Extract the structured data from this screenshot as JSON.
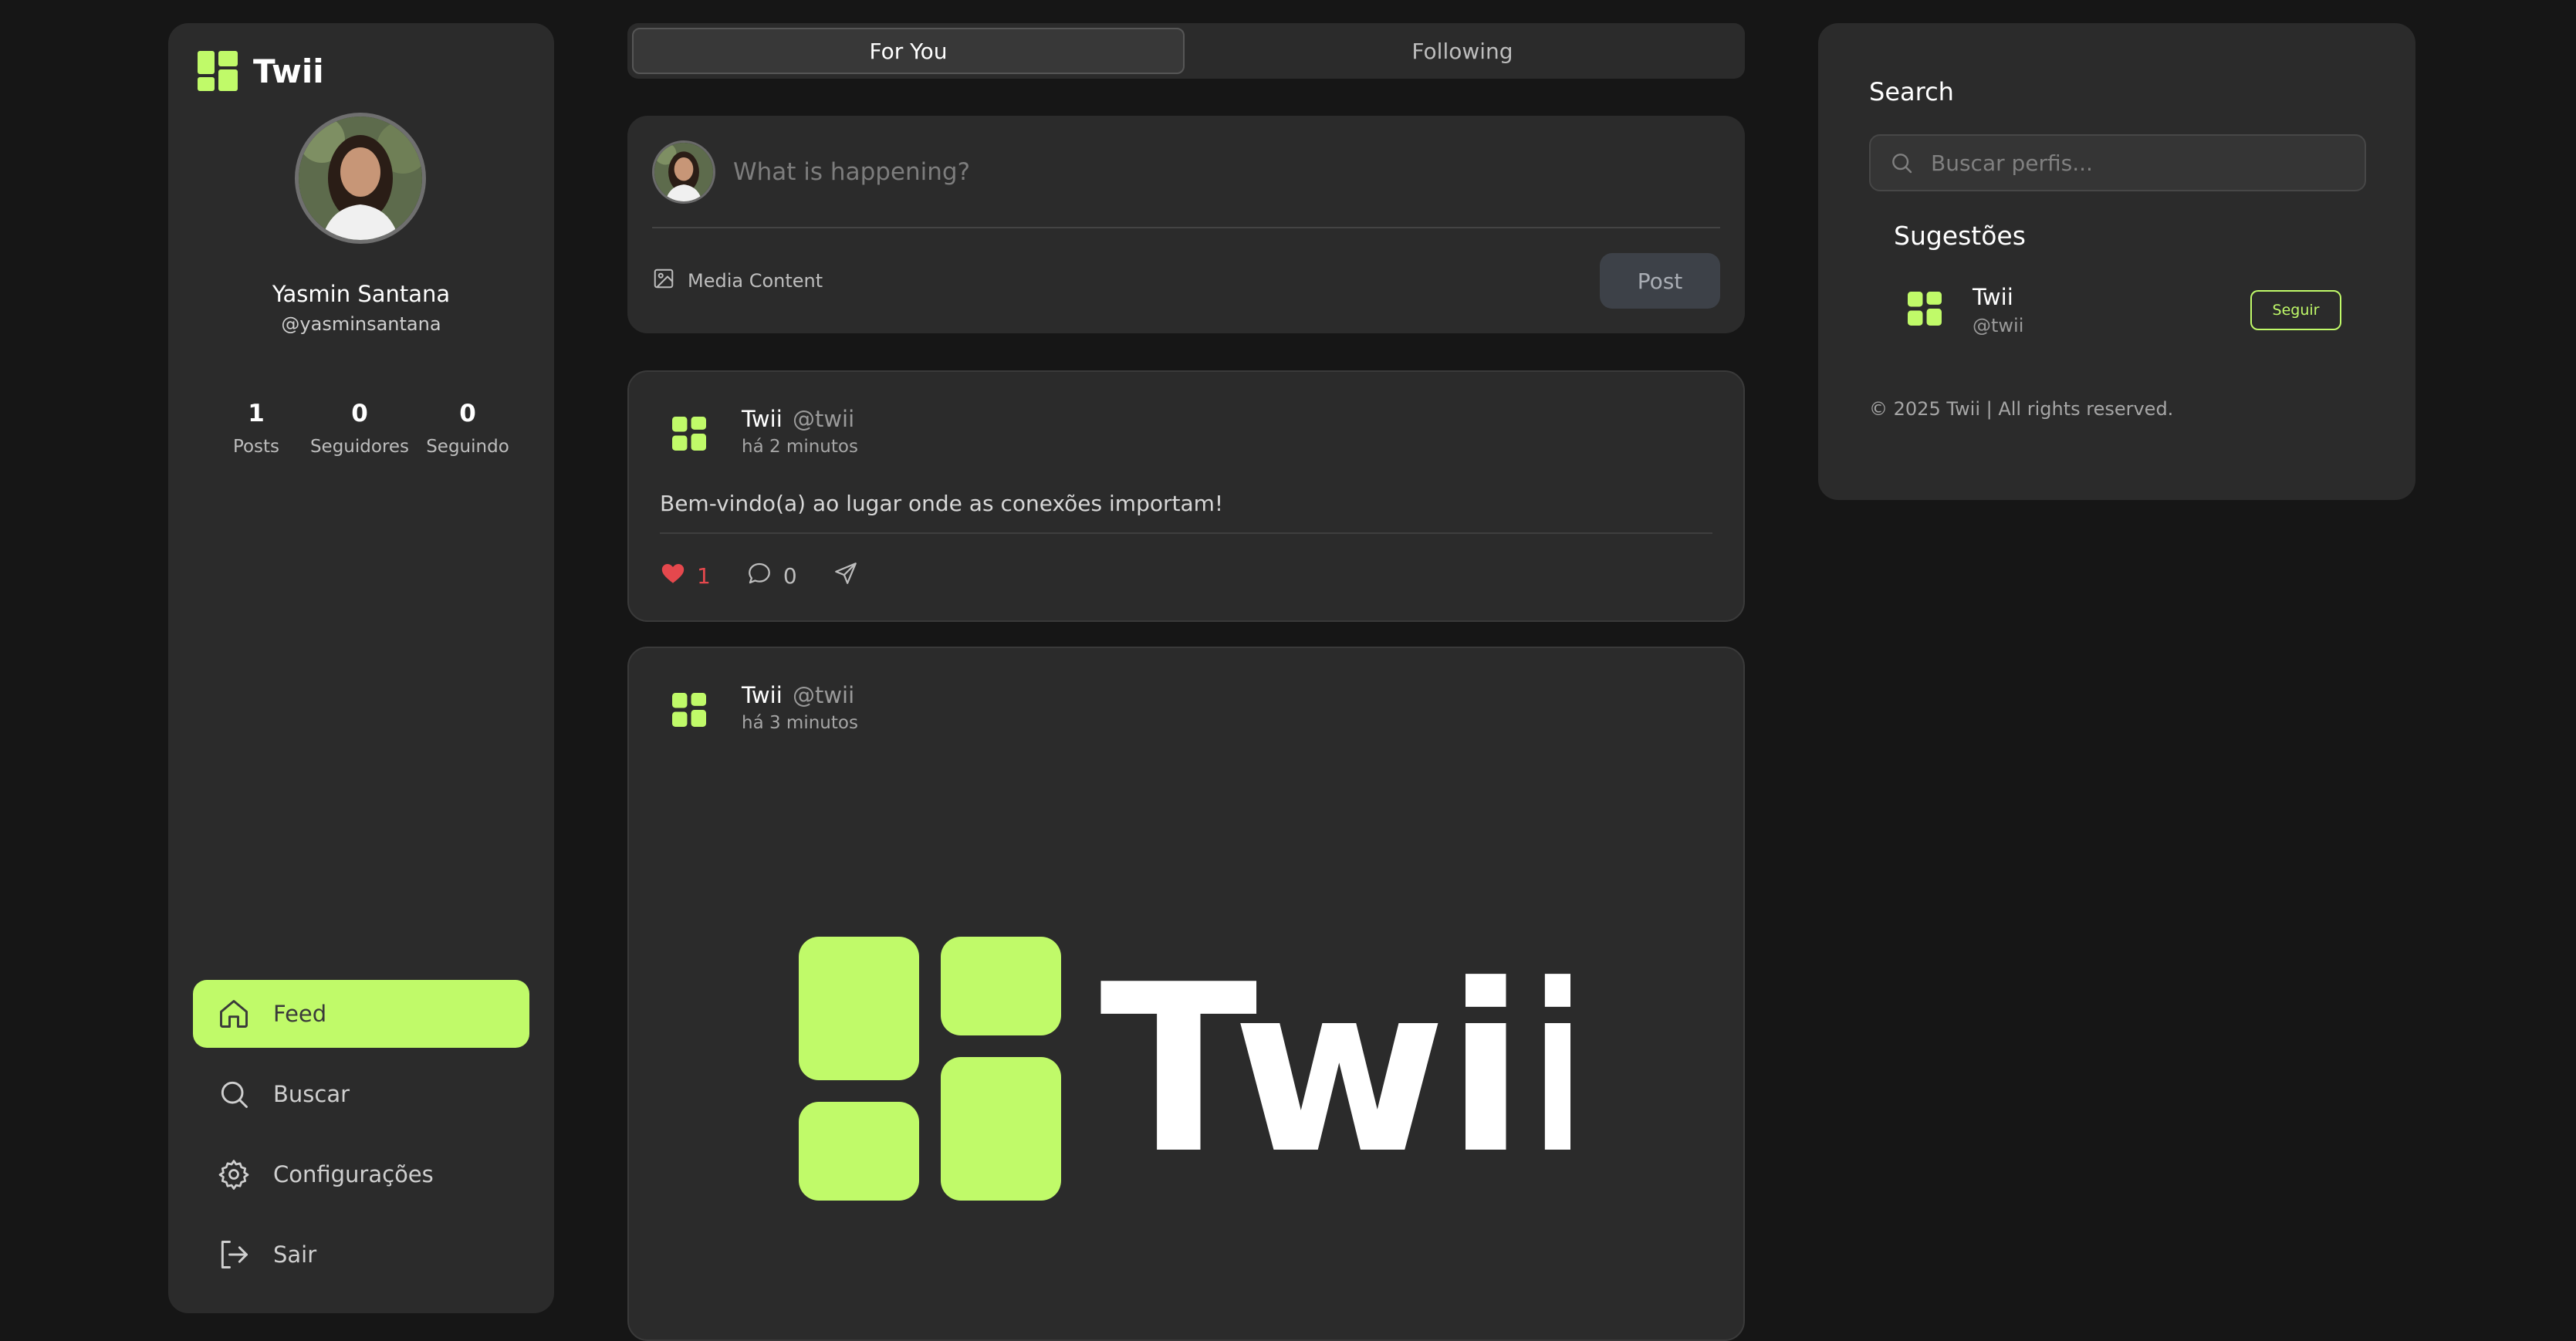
{
  "brand": {
    "name": "Twii",
    "accent": "#c0fa69"
  },
  "profile": {
    "name": "Yasmin Santana",
    "handle": "@yasminsantana",
    "stats": [
      {
        "value": "1",
        "label": "Posts"
      },
      {
        "value": "0",
        "label": "Seguidores"
      },
      {
        "value": "0",
        "label": "Seguindo"
      }
    ]
  },
  "nav": {
    "items": [
      {
        "label": "Feed",
        "icon": "home-icon",
        "active": true
      },
      {
        "label": "Buscar",
        "icon": "search-icon",
        "active": false
      },
      {
        "label": "Configurações",
        "icon": "gear-icon",
        "active": false
      },
      {
        "label": "Sair",
        "icon": "logout-icon",
        "active": false
      }
    ]
  },
  "tabs": [
    {
      "label": "For You",
      "active": true
    },
    {
      "label": "Following",
      "active": false
    }
  ],
  "composer": {
    "placeholder": "What is happening?",
    "media_label": "Media Content",
    "post_label": "Post"
  },
  "posts": [
    {
      "author": "Twii",
      "handle": "@twii",
      "time": "há 2 minutos",
      "text": "Bem-vindo(a) ao lugar onde as conexões importam!",
      "likes": "1",
      "comments": "0",
      "liked": true
    },
    {
      "author": "Twii",
      "handle": "@twii",
      "time": "há 3 minutos",
      "image_text": "Twii"
    }
  ],
  "right": {
    "search_title": "Search",
    "search_placeholder": "Buscar perfis...",
    "suggestions_title": "Sugestões",
    "suggestions": [
      {
        "name": "Twii",
        "handle": "@twii",
        "button": "Seguir"
      }
    ],
    "footer": "© 2025 Twii | All rights reserved."
  },
  "colors": {
    "like": "#e5484d",
    "background": "#161616",
    "panel": "#2b2b2b"
  }
}
